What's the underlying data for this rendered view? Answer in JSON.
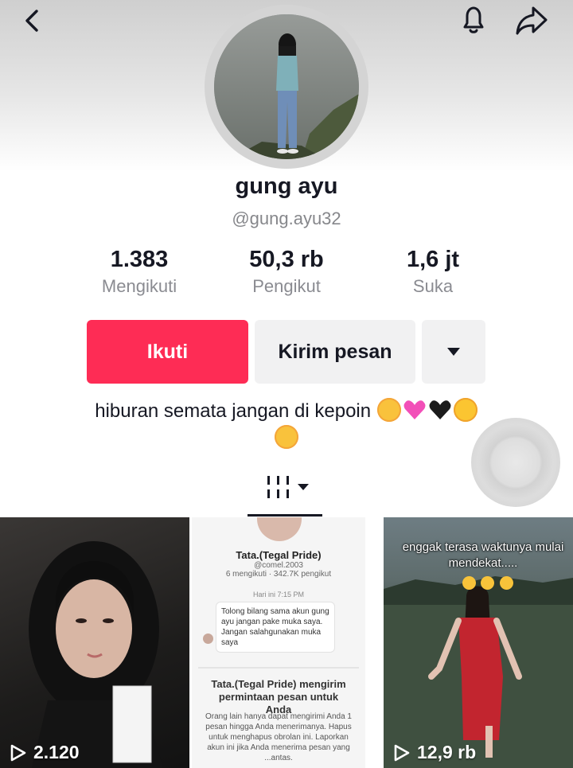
{
  "header": {
    "back_icon": "chevron-left-icon",
    "bell_icon": "bell-icon",
    "share_icon": "share-arrow-icon"
  },
  "profile": {
    "display_name": "gung ayu",
    "username": "@gung.ayu32"
  },
  "stats": [
    {
      "value": "1.383",
      "label": "Mengikuti"
    },
    {
      "value": "50,3 rb",
      "label": "Pengikut"
    },
    {
      "value": "1,6 jt",
      "label": "Suka"
    }
  ],
  "actions": {
    "follow_label": "Ikuti",
    "message_label": "Kirim pesan",
    "more_icon": "caret-down-icon",
    "follow_color": "#fe2c55"
  },
  "bio": {
    "text": "hiburan semata jangan di kepoin",
    "emojis_line1": [
      "smiling-face-with-hearts",
      "pink-heart",
      "black-heart",
      "heart-eyes"
    ],
    "emojis_line2": [
      "smiling-face-with-hearts"
    ]
  },
  "tabs": {
    "active_icon": "grid-icon"
  },
  "videos": [
    {
      "views": "2.120"
    },
    {
      "views": "",
      "chat": {
        "name": "Tata.(Tegal Pride)",
        "handle": "@comel.2003",
        "stats": "6 mengikuti · 342.7K pengikut",
        "time": "Hari ini 7:15 PM",
        "message": "Tolong bilang sama akun gung ayu jangan pake muka saya. Jangan salahgunakan muka saya",
        "request_title": "Tata.(Tegal Pride) mengirim permintaan pesan untuk Anda",
        "request_body": "Orang lain hanya dapat mengirimi Anda 1 pesan hingga Anda menerimanya. Hapus untuk menghapus obrolan ini. Laporkan akun ini jika Anda menerima pesan yang ...antas."
      }
    },
    {
      "views": "12,9 rb",
      "caption": "enggak terasa waktunya mulai mendekat....."
    }
  ]
}
